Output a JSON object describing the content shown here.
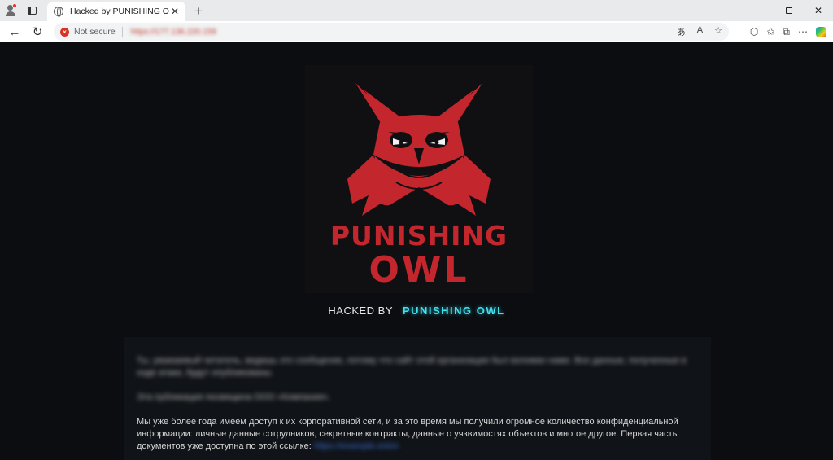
{
  "browser": {
    "tab_title": "Hacked by PUNISHING OWL",
    "tab_close": "✕",
    "new_tab": "+",
    "security_label": "Not secure",
    "url": "https://177.136.220.159",
    "window_minimize": "—",
    "window_restore": "",
    "window_close": "✕"
  },
  "page": {
    "logo_line1": "PUNISHING",
    "logo_line2": "OWL",
    "hacked_prefix": "HACKED BY",
    "hacked_group": "PUNISHING OWL",
    "para1_blurred": "Ты, уважаемый читатель, видишь это сообщение, потому что сайт этой организации был взломан нами. Все данные, полученные в ходе атаки, будут опубликованы.",
    "para2_blurred": "Эта публикация посвящена ООО «Компания».",
    "para3": "Мы уже более года имеем доступ к их корпоративной сети, и за это время мы получили огромное количество конфиденциальной информации: личные данные сотрудников, секретные контракты, данные о уязвимостях объектов и многое другое. Первая часть документов уже доступна по этой ссылке:",
    "link_blurred": "https://example.onion"
  }
}
